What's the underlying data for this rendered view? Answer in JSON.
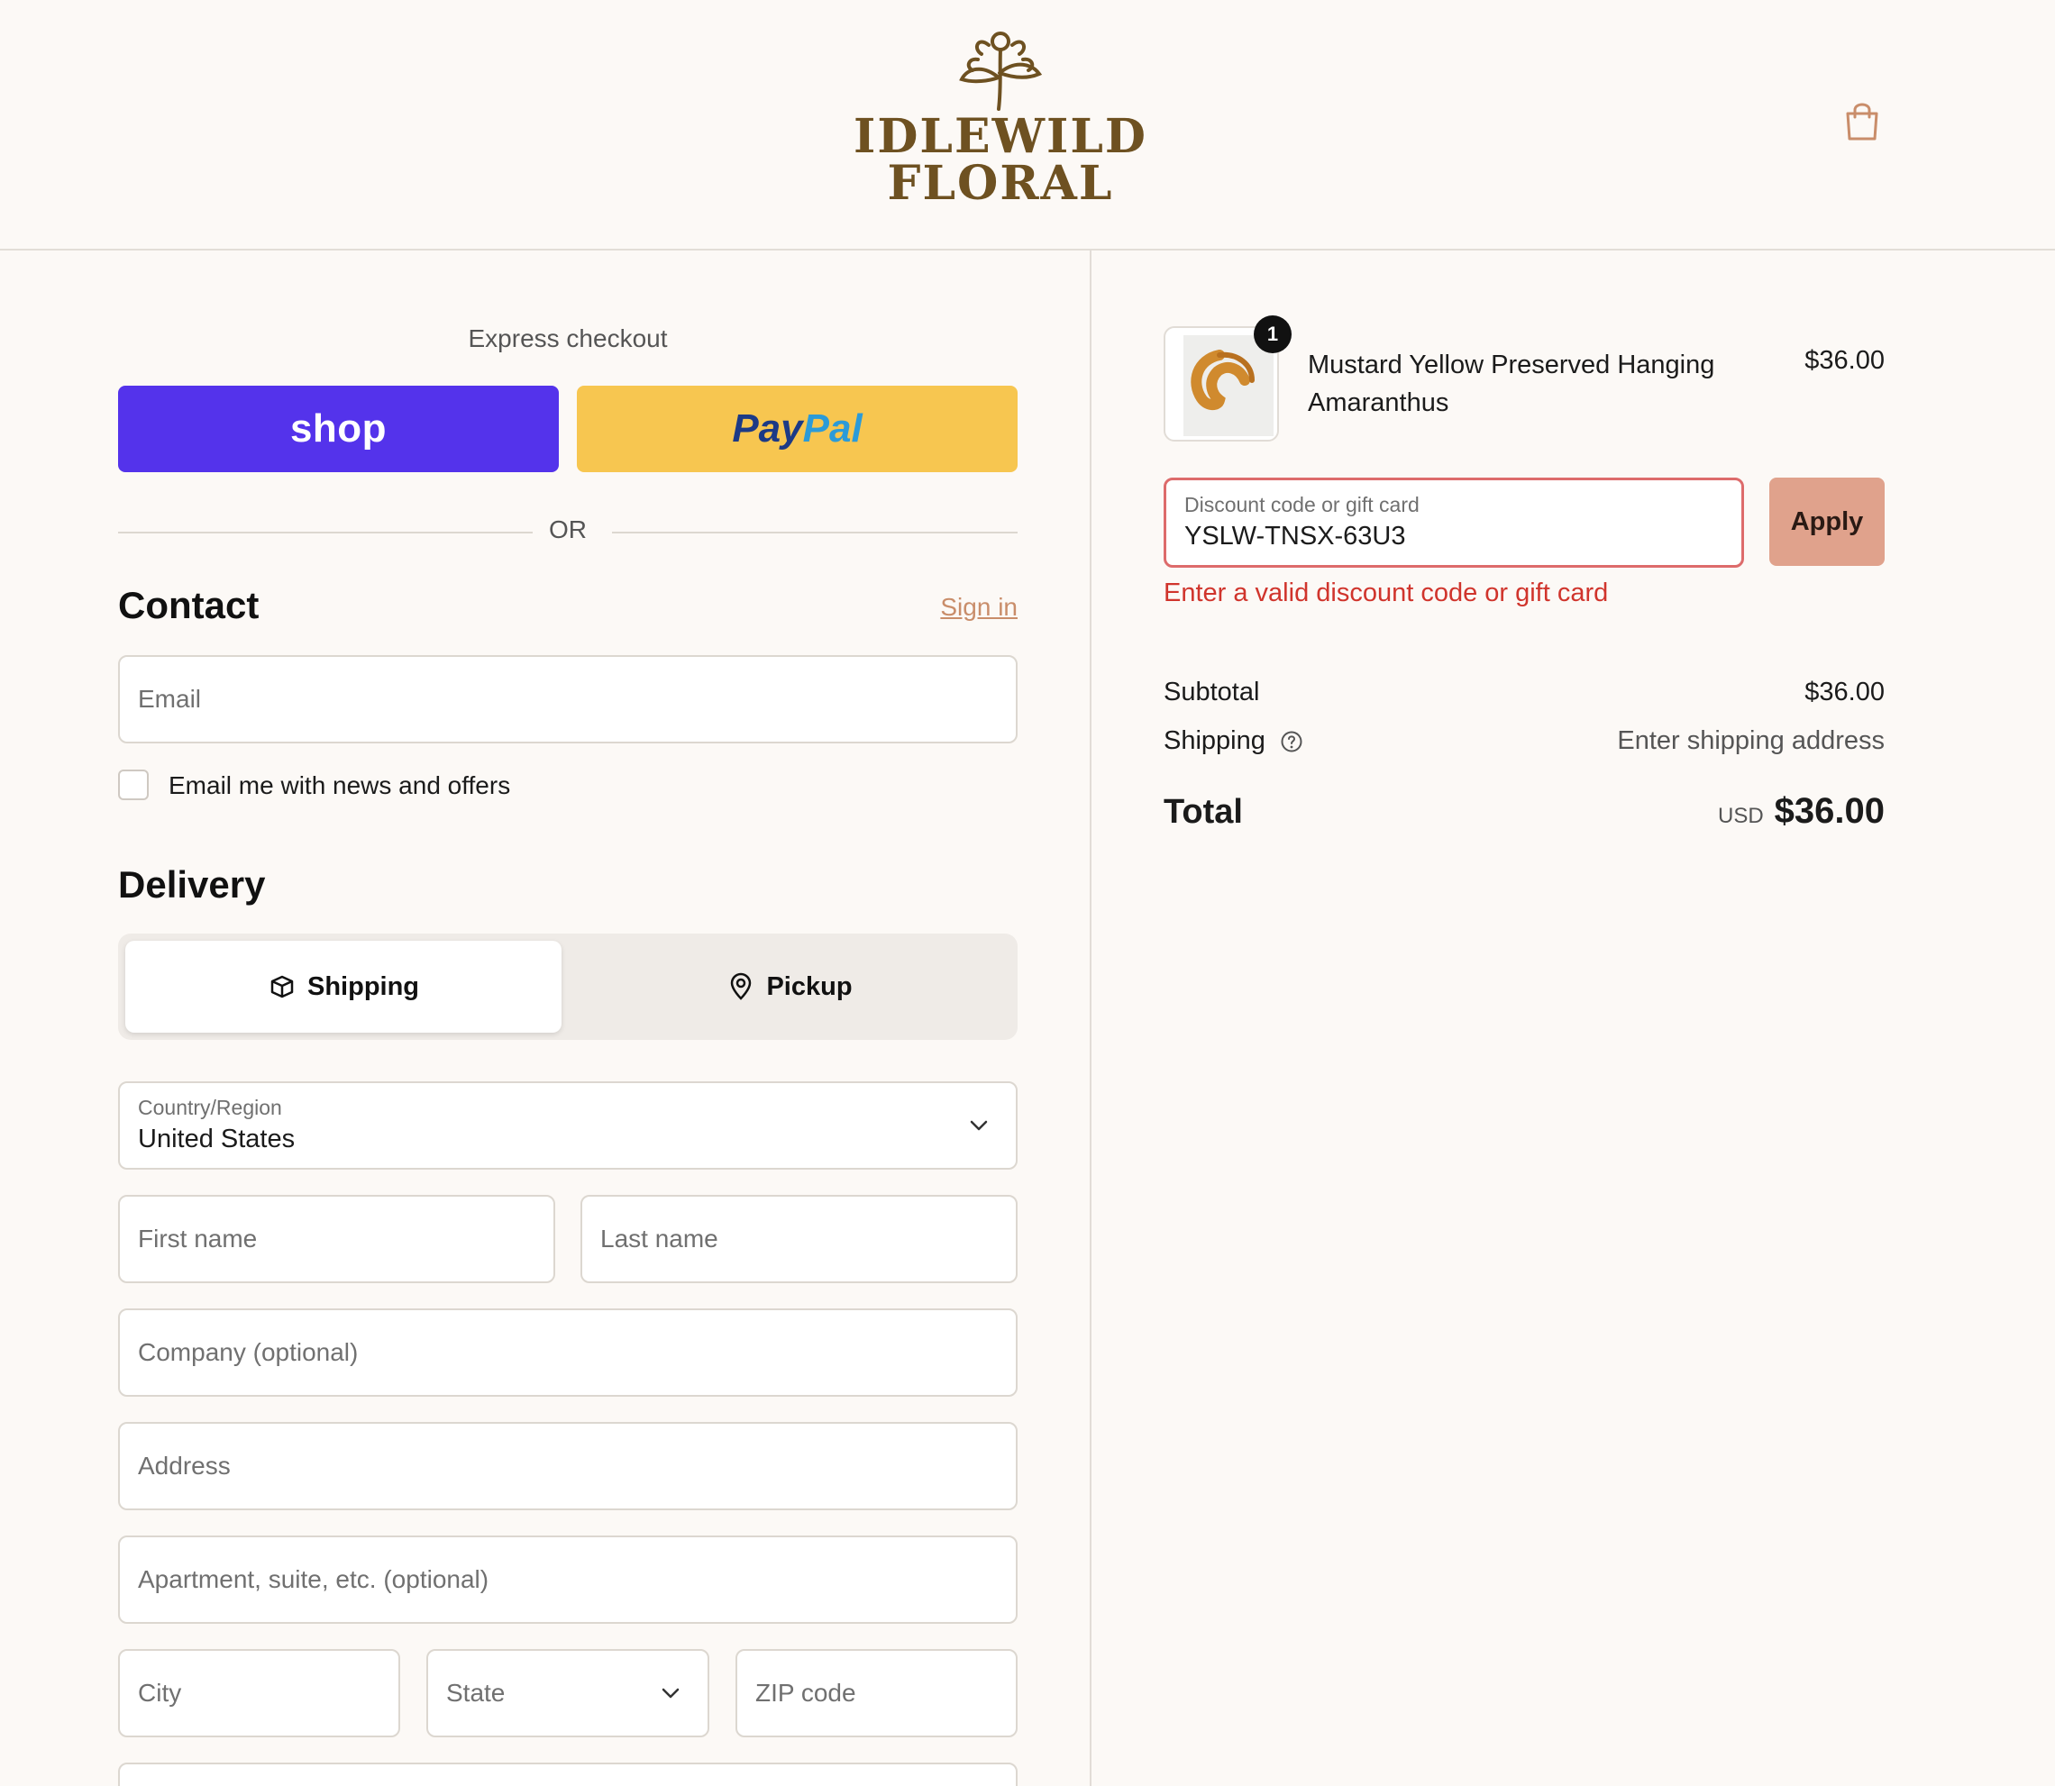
{
  "header": {
    "logo_line1": "IDLEWILD",
    "logo_line2": "FLORAL",
    "cart_icon": "shopping-bag-icon"
  },
  "express": {
    "title": "Express checkout",
    "shop_label": "shop",
    "paypal_label_1": "Pay",
    "paypal_label_2": "Pal",
    "or_label": "OR"
  },
  "contact": {
    "title": "Contact",
    "sign_in": "Sign in",
    "email_placeholder": "Email",
    "newsletter_label": "Email me with news and offers"
  },
  "delivery": {
    "title": "Delivery",
    "tab_shipping": "Shipping",
    "tab_pickup": "Pickup",
    "country_label": "Country/Region",
    "country_value": "United States",
    "first_name": "First name",
    "last_name": "Last name",
    "company": "Company (optional)",
    "address": "Address",
    "apartment": "Apartment, suite, etc. (optional)",
    "city": "City",
    "state": "State",
    "zip": "ZIP code"
  },
  "order": {
    "item_qty": "1",
    "item_name": "Mustard Yellow Preserved Hanging Amaranthus",
    "item_price": "$36.00",
    "discount_label": "Discount code or gift card",
    "discount_value": "YSLW-TNSX-63U3",
    "apply_label": "Apply",
    "discount_error": "Enter a valid discount code or gift card",
    "subtotal_label": "Subtotal",
    "subtotal_value": "$36.00",
    "shipping_label": "Shipping",
    "shipping_value": "Enter shipping address",
    "total_label": "Total",
    "total_currency": "USD",
    "total_value": "$36.00"
  },
  "colors": {
    "shop_button": "#5433eb",
    "paypal_button": "#f7c650",
    "error": "#d0342c",
    "apply_button": "#e0a28c",
    "brand": "#6e5121"
  }
}
